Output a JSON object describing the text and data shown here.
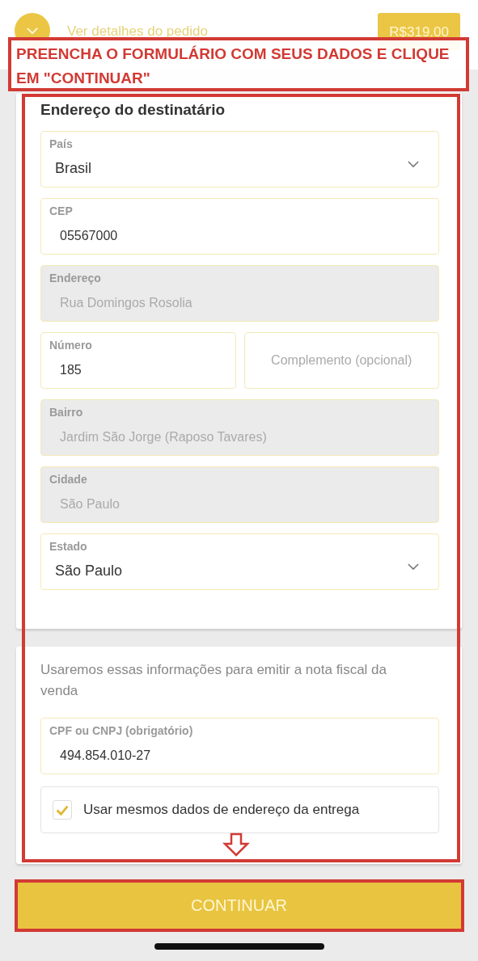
{
  "header": {
    "details_link": "Ver detalhes do pedido",
    "total": "R$319.00"
  },
  "annotation": {
    "banner": "PREENCHA O FORMULÁRIO COM SEUS DADOS E CLIQUE EM \"CONTINUAR\""
  },
  "address": {
    "title": "Endereço do destinatário",
    "fields": [
      {
        "kind": "select",
        "label": "País",
        "value": "Brasil"
      },
      {
        "kind": "text",
        "label": "CEP",
        "value": "05567000"
      },
      {
        "kind": "readonly",
        "label": "Endereço",
        "value": "Rua Domingos Rosolia"
      },
      {
        "kind": "row",
        "fields": [
          {
            "kind": "text",
            "label": "Número",
            "value": "185"
          },
          {
            "kind": "text",
            "placeholder": "Complemento (opcional)"
          }
        ]
      },
      {
        "kind": "readonly",
        "label": "Bairro",
        "value": "Jardim São Jorge (Raposo Tavares)"
      },
      {
        "kind": "readonly",
        "label": "Cidade",
        "value": "São Paulo"
      },
      {
        "kind": "select",
        "label": "Estado",
        "value": "São Paulo"
      }
    ]
  },
  "invoice": {
    "note": "Usaremos essas informações para emitir a nota fiscal da venda",
    "fields": [
      {
        "kind": "text",
        "label": "CPF ou CNPJ (obrigatório)",
        "value": "494.854.010-27"
      }
    ],
    "same_address": {
      "label": "Usar mesmos dados de endereço da entrega",
      "checked": true
    }
  },
  "continue_button": "CONTINUAR"
}
